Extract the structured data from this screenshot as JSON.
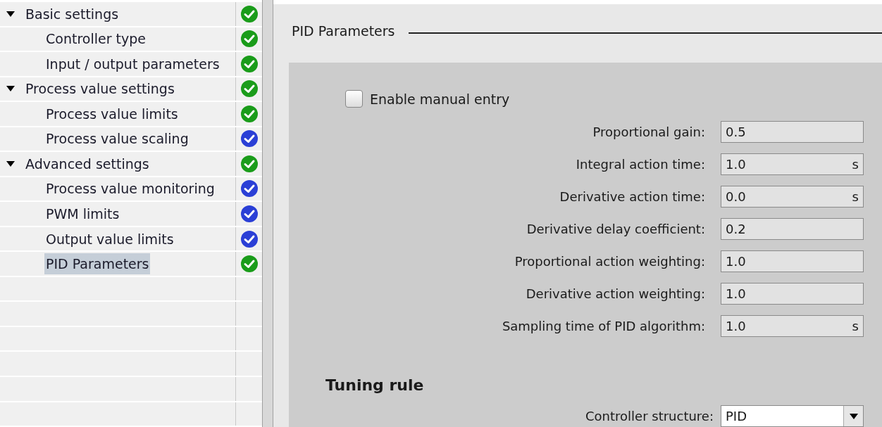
{
  "tree": [
    {
      "label": "Basic settings",
      "expanded": true,
      "selected": false,
      "color": "#1a9c1a",
      "children": [
        {
          "label": "Controller type",
          "selected": false,
          "color": "#1a9c1a"
        },
        {
          "label": "Input / output parameters",
          "selected": false,
          "color": "#1a9c1a"
        }
      ]
    },
    {
      "label": "Process value settings",
      "expanded": true,
      "selected": false,
      "color": "#1a9c1a",
      "children": [
        {
          "label": "Process value limits",
          "selected": false,
          "color": "#1a9c1a"
        },
        {
          "label": "Process value scaling",
          "selected": false,
          "color": "#2a3fd6"
        }
      ]
    },
    {
      "label": "Advanced settings",
      "expanded": true,
      "selected": false,
      "color": "#1a9c1a",
      "children": [
        {
          "label": "Process value monitoring",
          "selected": false,
          "color": "#2a3fd6"
        },
        {
          "label": "PWM limits",
          "selected": false,
          "color": "#2a3fd6"
        },
        {
          "label": "Output value limits",
          "selected": false,
          "color": "#2a3fd6"
        },
        {
          "label": "PID Parameters",
          "selected": true,
          "color": "#1a9c1a"
        }
      ]
    }
  ],
  "section": {
    "title": "PID Parameters",
    "manual_entry": {
      "label": "Enable manual entry",
      "checked": false
    },
    "parameters": [
      {
        "label": "Proportional gain:",
        "value": "0.5"
      },
      {
        "label": "Integral action time:",
        "value": "1.0",
        "unit": "s"
      },
      {
        "label": "Derivative action time:",
        "value": "0.0",
        "unit": "s"
      },
      {
        "label": "Derivative delay coefficient:",
        "value": "0.2"
      },
      {
        "label": "Proportional action weighting:",
        "value": "1.0"
      },
      {
        "label": "Derivative action weighting:",
        "value": "1.0"
      },
      {
        "label": "Sampling time of PID algorithm:",
        "value": "1.0",
        "unit": "s"
      }
    ],
    "tuning_rule": {
      "title": "Tuning rule",
      "controller_structure": {
        "label": "Controller structure:",
        "value": "PID"
      }
    }
  }
}
